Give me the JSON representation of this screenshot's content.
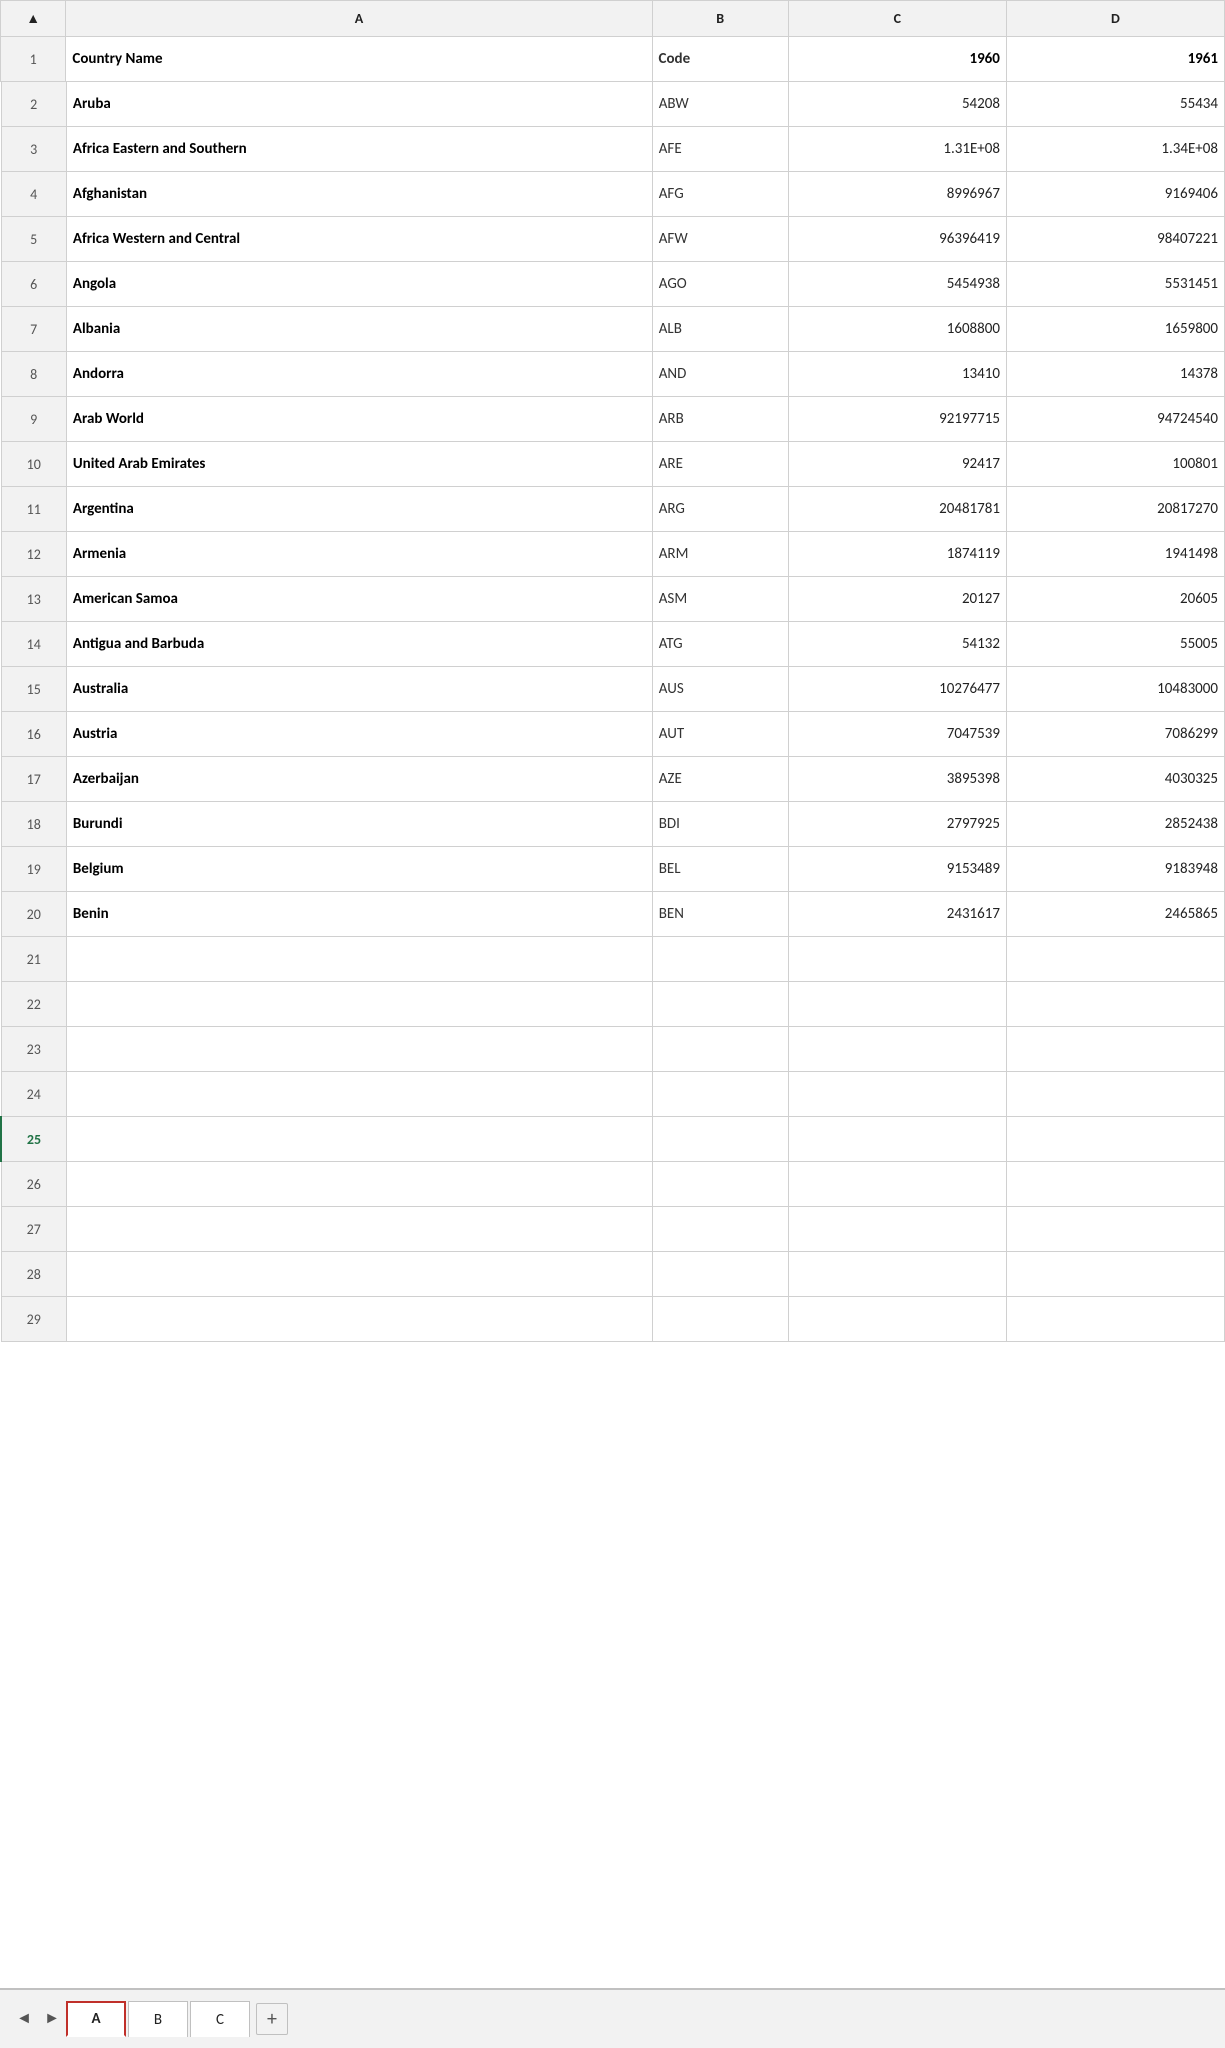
{
  "columns": {
    "rownum": "",
    "a": "A",
    "b": "B",
    "c": "C",
    "d": "D"
  },
  "header_row": {
    "rownum": "",
    "a": "Country Name",
    "b": "Code",
    "c": "1960",
    "d": "1961"
  },
  "rows": [
    {
      "rownum": "2",
      "a": "Aruba",
      "b": "ABW",
      "c": "54208",
      "d": "55434"
    },
    {
      "rownum": "3",
      "a": "Africa Eastern and Southern",
      "b": "AFE",
      "c": "1.31E+08",
      "d": "1.34E+08"
    },
    {
      "rownum": "4",
      "a": "Afghanistan",
      "b": "AFG",
      "c": "8996967",
      "d": "9169406"
    },
    {
      "rownum": "5",
      "a": "Africa Western and Central",
      "b": "AFW",
      "c": "96396419",
      "d": "98407221"
    },
    {
      "rownum": "6",
      "a": "Angola",
      "b": "AGO",
      "c": "5454938",
      "d": "5531451"
    },
    {
      "rownum": "7",
      "a": "Albania",
      "b": "ALB",
      "c": "1608800",
      "d": "1659800"
    },
    {
      "rownum": "8",
      "a": "Andorra",
      "b": "AND",
      "c": "13410",
      "d": "14378"
    },
    {
      "rownum": "9",
      "a": "Arab World",
      "b": "ARB",
      "c": "92197715",
      "d": "94724540"
    },
    {
      "rownum": "10",
      "a": "United Arab Emirates",
      "b": "ARE",
      "c": "92417",
      "d": "100801"
    },
    {
      "rownum": "11",
      "a": "Argentina",
      "b": "ARG",
      "c": "20481781",
      "d": "20817270"
    },
    {
      "rownum": "12",
      "a": "Armenia",
      "b": "ARM",
      "c": "1874119",
      "d": "1941498"
    },
    {
      "rownum": "13",
      "a": "American Samoa",
      "b": "ASM",
      "c": "20127",
      "d": "20605"
    },
    {
      "rownum": "14",
      "a": "Antigua and Barbuda",
      "b": "ATG",
      "c": "54132",
      "d": "55005"
    },
    {
      "rownum": "15",
      "a": "Australia",
      "b": "AUS",
      "c": "10276477",
      "d": "10483000"
    },
    {
      "rownum": "16",
      "a": "Austria",
      "b": "AUT",
      "c": "7047539",
      "d": "7086299"
    },
    {
      "rownum": "17",
      "a": "Azerbaijan",
      "b": "AZE",
      "c": "3895398",
      "d": "4030325"
    },
    {
      "rownum": "18",
      "a": "Burundi",
      "b": "BDI",
      "c": "2797925",
      "d": "2852438"
    },
    {
      "rownum": "19",
      "a": "Belgium",
      "b": "BEL",
      "c": "9153489",
      "d": "9183948"
    },
    {
      "rownum": "20",
      "a": "Benin",
      "b": "BEN",
      "c": "2431617",
      "d": "2465865"
    }
  ],
  "empty_rows": [
    "21",
    "22",
    "23",
    "24",
    "25",
    "26",
    "27",
    "28",
    "29"
  ],
  "active_row": "25",
  "tabs": [
    {
      "label": "A",
      "active": true
    },
    {
      "label": "B",
      "active": false
    },
    {
      "label": "C",
      "active": false
    }
  ],
  "add_sheet_label": "+",
  "nav_prev": "◄",
  "nav_next": "►"
}
